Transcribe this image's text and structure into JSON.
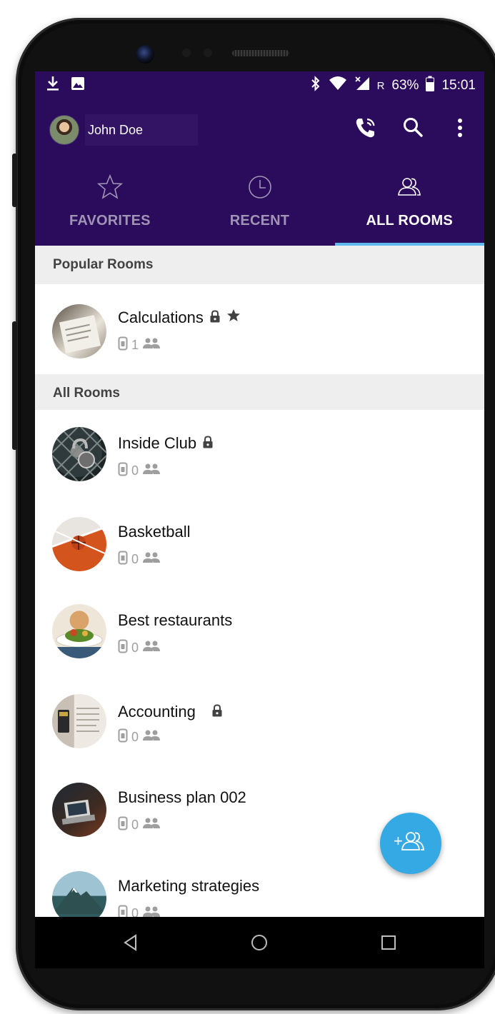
{
  "status_bar": {
    "battery": "63%",
    "roaming": "R",
    "time": "15:01"
  },
  "header": {
    "user_name": "John Doe"
  },
  "tabs": [
    {
      "label": "FAVORITES",
      "icon": "star-outline-icon",
      "active": false
    },
    {
      "label": "RECENT",
      "icon": "clock-icon",
      "active": false
    },
    {
      "label": "ALL ROOMS",
      "icon": "group-icon",
      "active": true
    }
  ],
  "sections": {
    "popular": "Popular Rooms",
    "all": "All Rooms"
  },
  "popular_rooms": [
    {
      "name": "Calculations",
      "locked": true,
      "favorite": true,
      "devices": "1"
    }
  ],
  "rooms": [
    {
      "name": "Inside Club",
      "locked": true,
      "devices": "0"
    },
    {
      "name": "Basketball",
      "locked": false,
      "devices": "0"
    },
    {
      "name": "Best restaurants",
      "locked": false,
      "devices": "0"
    },
    {
      "name": "Accounting",
      "locked": true,
      "devices": "0"
    },
    {
      "name": "Business plan 002",
      "locked": false,
      "devices": "0"
    },
    {
      "name": "Marketing strategies",
      "locked": false,
      "devices": "0"
    }
  ],
  "fab": {
    "label": "+"
  },
  "colors": {
    "appbar": "#2b0b5c",
    "indicator": "#5fb9ee",
    "fab": "#35a9e3",
    "section_bg": "#eeeeee"
  }
}
